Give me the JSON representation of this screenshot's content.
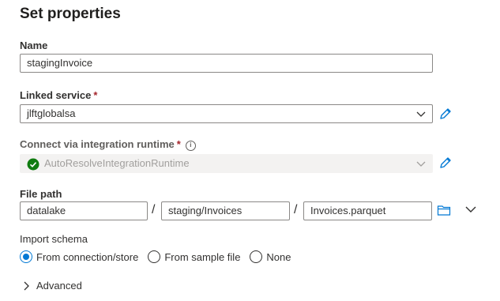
{
  "panel": {
    "title": "Set properties"
  },
  "name_field": {
    "label": "Name",
    "value": "stagingInvoice"
  },
  "linked_service": {
    "label": "Linked service",
    "required_mark": "*",
    "value": "jlftglobalsa"
  },
  "runtime": {
    "label": "Connect via integration runtime",
    "required_mark": "*",
    "info_glyph": "i",
    "value": "AutoResolveIntegrationRuntime"
  },
  "file_path": {
    "label": "File path",
    "container": "datalake",
    "directory": "staging/Invoices",
    "file": "Invoices.parquet",
    "separator": "/"
  },
  "import_schema": {
    "label": "Import schema",
    "options": [
      "From connection/store",
      "From sample file",
      "None"
    ],
    "selected": "From connection/store"
  },
  "advanced": {
    "label": "Advanced"
  },
  "colors": {
    "accent": "#0078d4",
    "success": "#107c10",
    "required": "#a4262c"
  },
  "icons": [
    "pencil-icon",
    "chevron-down-icon",
    "folder-icon",
    "chevron-right-icon",
    "check-circle-icon",
    "info-icon"
  ]
}
